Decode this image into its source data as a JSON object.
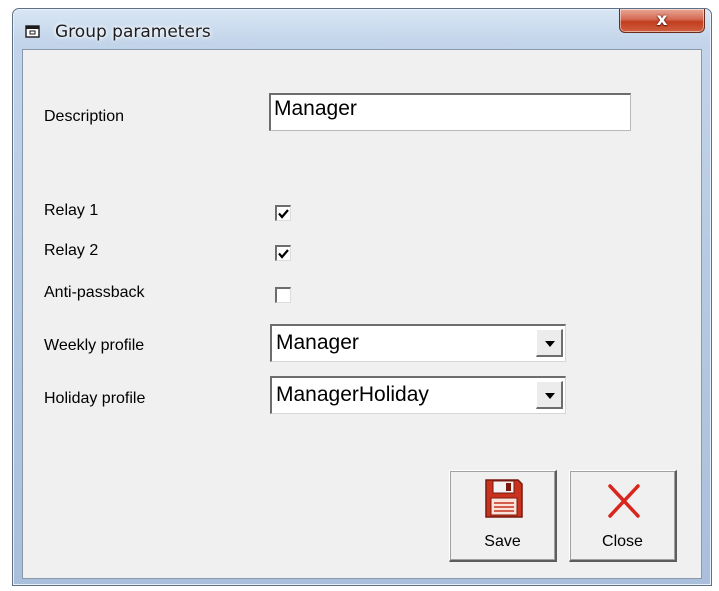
{
  "window": {
    "title": "Group parameters",
    "close_glyph": "x"
  },
  "form": {
    "description": {
      "label": "Description",
      "value": "Manager"
    },
    "relay1": {
      "label": "Relay 1",
      "checked": true
    },
    "relay2": {
      "label": "Relay 2",
      "checked": true
    },
    "antipassback": {
      "label": "Anti-passback",
      "checked": false
    },
    "weekly_profile": {
      "label": "Weekly profile",
      "selected": "Manager"
    },
    "holiday_profile": {
      "label": "Holiday profile",
      "selected": "ManagerHoliday"
    }
  },
  "buttons": {
    "save": {
      "label": "Save",
      "icon": "floppy-disk-icon"
    },
    "close": {
      "label": "Close",
      "icon": "red-x-icon"
    }
  },
  "colors": {
    "close_x": "#d9261c",
    "floppy": "#c8321e",
    "title_close_btn": "#c94a2e"
  }
}
